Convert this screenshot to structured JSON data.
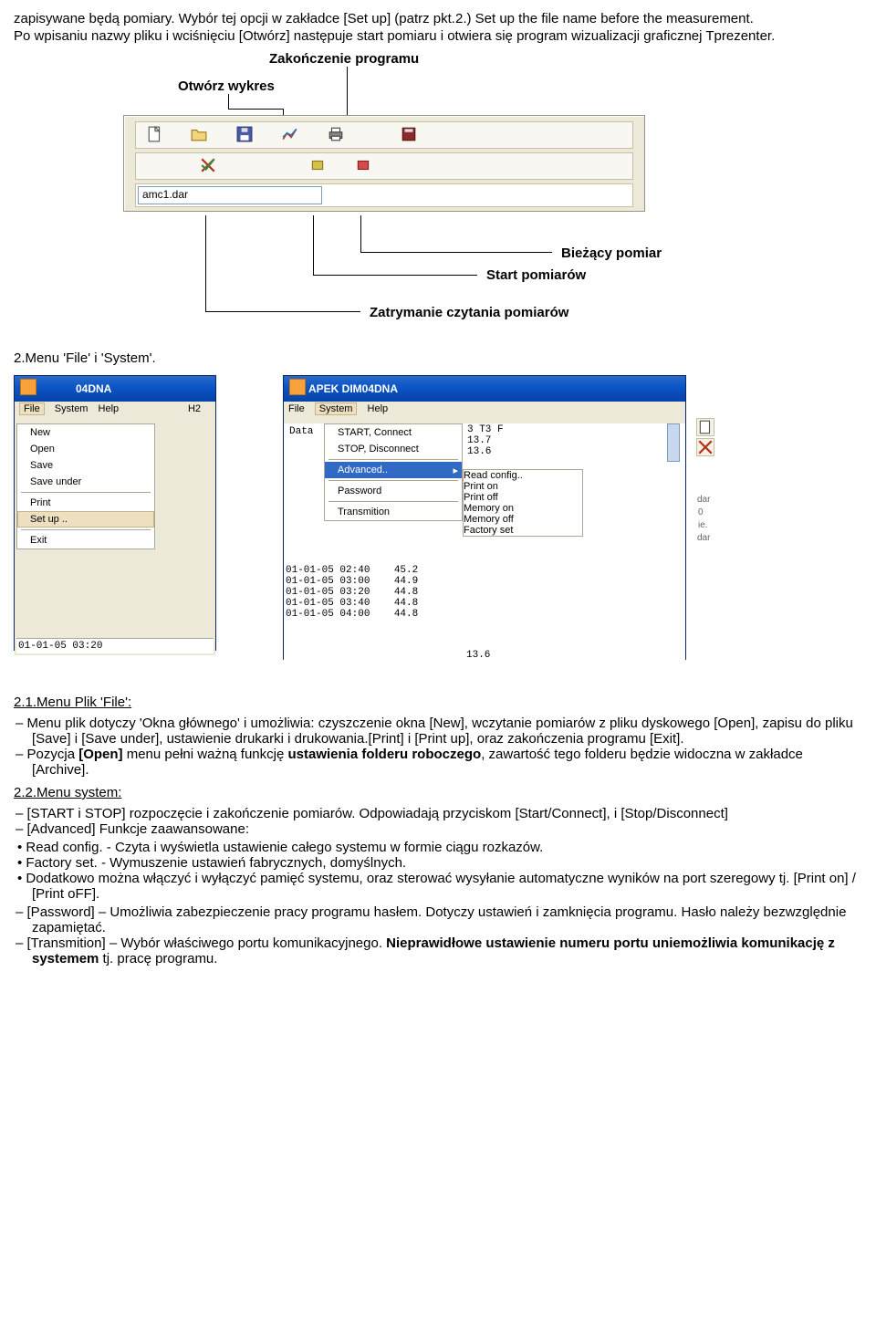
{
  "intro1": "zapisywane będą pomiary. Wybór tej opcji w zakładce [Set up] (patrz pkt.2.) Set up the file name before the measurement.",
  "intro2": "Po wpisaniu nazwy pliku i wciśnięciu [Otwórz] następuje start pomiaru i otwiera się program wizualizacji graficznej Tprezenter.",
  "diagram": {
    "callout1": "Zakończenie programu",
    "callout2": "Otwórz wykres",
    "callout3": "Bieżący pomiar",
    "callout4": "Start pomiarów",
    "callout5": "Zatrymanie  czytania pomiarów",
    "filename": "amc1.dar"
  },
  "sec2": "2.Menu 'File' i 'System'.",
  "win1": {
    "title": "04DNA",
    "menu_file": "File",
    "menu_system": "System",
    "menu_help": "Help",
    "h2": "H2",
    "items": [
      "New",
      "Open",
      "Save",
      "Save under",
      "Print",
      "Set up ..",
      "Exit"
    ],
    "bottomline": "01-01-05 03:20"
  },
  "win2": {
    "title": "APEK DIM04DNA",
    "menu_file": "File",
    "menu_system": "System",
    "menu_help": "Help",
    "header": "Data",
    "headercol": "3 T3 F",
    "items": [
      "START, Connect",
      "STOP, Disconnect",
      "Advanced..",
      "Password",
      "Transmition"
    ],
    "rows": [
      "01-01-05 02:40    45.2",
      "01-01-05 03:00    44.9",
      "01-01-05 03:20    44.8",
      "01-01-05 03:40    44.8",
      "01-01-05 04:00    44.8"
    ],
    "rightvals": [
      "13.7",
      "13.6",
      "",
      "",
      "",
      "",
      "",
      "",
      "",
      "13.6"
    ],
    "submenu": [
      "Read config..",
      "Print on",
      "Print off",
      "Memory on",
      "Memory off",
      "Factory set"
    ]
  },
  "sec21": "2.1.Menu Plik 'File':",
  "sec21_li1": "Menu plik dotyczy 'Okna głównego' i umożliwia: czyszczenie okna [New], wczytanie pomiarów z pliku dyskowego [Open], zapisu do pliku [Save] i [Save under], ustawienie drukarki i drukowania.[Print] i [Print up], oraz zakończenia programu [Exit].",
  "sec21_li2a": "Pozycja ",
  "sec21_li2b": "[Open]",
  "sec21_li2c": " menu pełni ważną funkcję ",
  "sec21_li2d": "ustawienia folderu roboczego",
  "sec21_li2e": ", zawartość tego folderu będzie widoczna w zakładce [Archive].",
  "sec22": "2.2.Menu system:",
  "sec22_li1": "[START i STOP] rozpoczęcie i zakończenie pomiarów. Odpowiadają przyciskom [Start/Connect], i [Stop/Disconnect]",
  "sec22_li2": "[Advanced] Funkcje zaawansowane:",
  "sec22_li2a": "Read config. - Czyta i wyświetla ustawienie całego systemu w formie ciągu rozkazów.",
  "sec22_li2b": "Factory set. - Wymuszenie ustawień fabrycznych, domyślnych.",
  "sec22_li2c": "Dodatkowo można włączyć i wyłączyć pamięć systemu, oraz sterować wysyłanie automatyczne wyników na port szeregowy tj. [Print on] / [Print oFF].",
  "sec22_li3a": "[Password] – Umożliwia zabezpieczenie pracy programu hasłem. ",
  "sec22_li3b": "Dotyczy ustawień i zamknięcia programu. Hasło należy bezwzględnie zapamiętać.",
  "sec22_li4a": "[Transmition] – Wybór właściwego portu komunikacyjnego. ",
  "sec22_li4b": "Nieprawidłowe ustawienie numeru portu uniemożliwia komunikację z systemem",
  "sec22_li4c": " tj. pracę programu."
}
